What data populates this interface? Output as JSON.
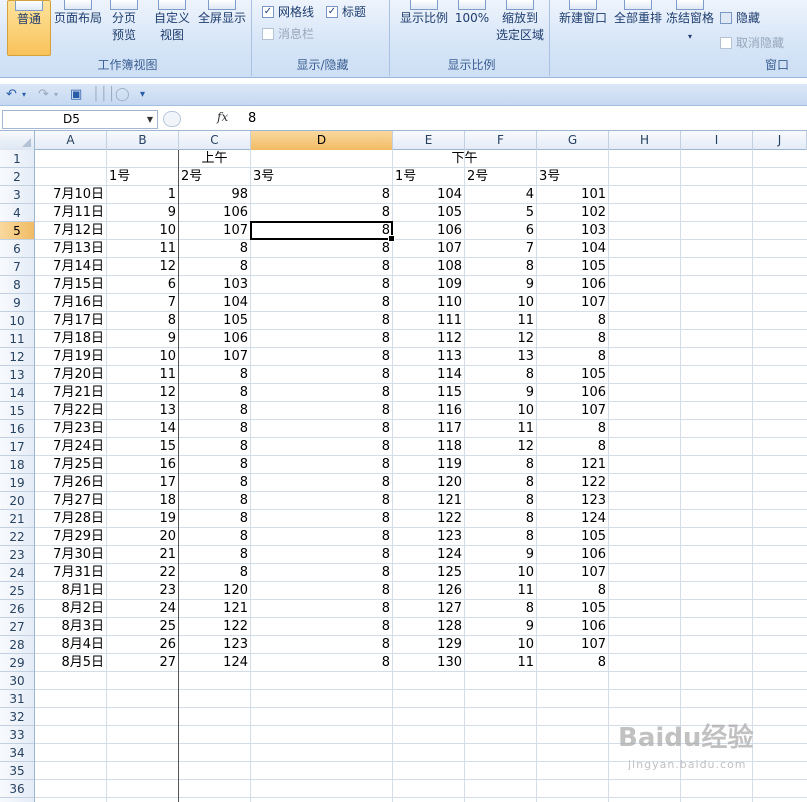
{
  "ribbon": {
    "workbook_views": {
      "group_label": "工作簿视图",
      "normal": "普通",
      "page_layout": "页面布局",
      "page_break_preview_line1": "分页",
      "page_break_preview_line2": "预览",
      "custom_views_line1": "自定义",
      "custom_views_line2": "视图",
      "full_screen": "全屏显示"
    },
    "show_hide": {
      "group_label": "显示/隐藏",
      "gridlines": "网格线",
      "gridlines_checked": true,
      "headings": "标题",
      "headings_checked": true,
      "message_bar": "消息栏",
      "message_bar_checked": false
    },
    "zoom": {
      "group_label": "显示比例",
      "zoom": "显示比例",
      "zoom_100": "100%",
      "zoom_selection_line1": "缩放到",
      "zoom_selection_line2": "选定区域"
    },
    "window": {
      "group_label": "窗口",
      "new_window": "新建窗口",
      "arrange_all": "全部重排",
      "freeze_panes": "冻结窗格",
      "hide": "隐藏",
      "unhide": "取消隐藏"
    }
  },
  "formula_bar": {
    "name_box": "D5",
    "fx": "fx",
    "value": "8"
  },
  "columns": [
    "A",
    "B",
    "C",
    "D",
    "E",
    "F",
    "G",
    "H",
    "I",
    "J"
  ],
  "selected_column": "D",
  "selected_row": 5,
  "rows_visible": [
    "1",
    "2",
    "3",
    "4",
    "5",
    "6",
    "7",
    "8",
    "9",
    "10",
    "11",
    "12",
    "13",
    "14",
    "15",
    "16",
    "17",
    "18",
    "19",
    "20",
    "21",
    "22",
    "23",
    "24",
    "25",
    "26",
    "27",
    "28",
    "29",
    "30",
    "31",
    "32",
    "33",
    "34",
    "35",
    "36"
  ],
  "sheet": {
    "header_row1": {
      "morning": "上午",
      "afternoon": "下午"
    },
    "header_row2": {
      "b": "1号",
      "c": "2号",
      "d": "3号",
      "e": "1号",
      "f": "2号",
      "g": "3号"
    },
    "data": [
      [
        "7月10日",
        "1",
        "98",
        "8",
        "104",
        "4",
        "101"
      ],
      [
        "7月11日",
        "9",
        "106",
        "8",
        "105",
        "5",
        "102"
      ],
      [
        "7月12日",
        "10",
        "107",
        "8",
        "106",
        "6",
        "103"
      ],
      [
        "7月13日",
        "11",
        "8",
        "8",
        "107",
        "7",
        "104"
      ],
      [
        "7月14日",
        "12",
        "8",
        "8",
        "108",
        "8",
        "105"
      ],
      [
        "7月15日",
        "6",
        "103",
        "8",
        "109",
        "9",
        "106"
      ],
      [
        "7月16日",
        "7",
        "104",
        "8",
        "110",
        "10",
        "107"
      ],
      [
        "7月17日",
        "8",
        "105",
        "8",
        "111",
        "11",
        "8"
      ],
      [
        "7月18日",
        "9",
        "106",
        "8",
        "112",
        "12",
        "8"
      ],
      [
        "7月19日",
        "10",
        "107",
        "8",
        "113",
        "13",
        "8"
      ],
      [
        "7月20日",
        "11",
        "8",
        "8",
        "114",
        "8",
        "105"
      ],
      [
        "7月21日",
        "12",
        "8",
        "8",
        "115",
        "9",
        "106"
      ],
      [
        "7月22日",
        "13",
        "8",
        "8",
        "116",
        "10",
        "107"
      ],
      [
        "7月23日",
        "14",
        "8",
        "8",
        "117",
        "11",
        "8"
      ],
      [
        "7月24日",
        "15",
        "8",
        "8",
        "118",
        "12",
        "8"
      ],
      [
        "7月25日",
        "16",
        "8",
        "8",
        "119",
        "8",
        "121"
      ],
      [
        "7月26日",
        "17",
        "8",
        "8",
        "120",
        "8",
        "122"
      ],
      [
        "7月27日",
        "18",
        "8",
        "8",
        "121",
        "8",
        "123"
      ],
      [
        "7月28日",
        "19",
        "8",
        "8",
        "122",
        "8",
        "124"
      ],
      [
        "7月29日",
        "20",
        "8",
        "8",
        "123",
        "8",
        "105"
      ],
      [
        "7月30日",
        "21",
        "8",
        "8",
        "124",
        "9",
        "106"
      ],
      [
        "7月31日",
        "22",
        "8",
        "8",
        "125",
        "10",
        "107"
      ],
      [
        "8月1日",
        "23",
        "120",
        "8",
        "126",
        "11",
        "8"
      ],
      [
        "8月2日",
        "24",
        "121",
        "8",
        "127",
        "8",
        "105"
      ],
      [
        "8月3日",
        "25",
        "122",
        "8",
        "128",
        "9",
        "106"
      ],
      [
        "8月4日",
        "26",
        "123",
        "8",
        "129",
        "10",
        "107"
      ],
      [
        "8月5日",
        "27",
        "124",
        "8",
        "130",
        "11",
        "8"
      ]
    ]
  },
  "watermark": {
    "brand": "Baidu经验",
    "url": "jingyan.baidu.com"
  }
}
